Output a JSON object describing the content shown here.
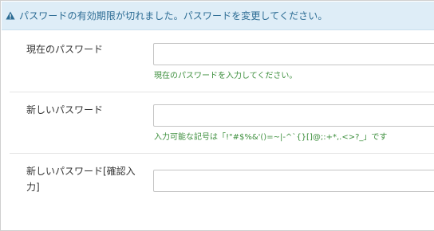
{
  "alert": {
    "icon": "warning-icon",
    "message": "パスワードの有効期限が切れました。パスワードを変更してください。"
  },
  "form": {
    "current_password": {
      "label": "現在のパスワード",
      "value": "",
      "hint": "現在のパスワードを入力してください。"
    },
    "new_password": {
      "label": "新しいパスワード",
      "value": "",
      "hint": "入力可能な記号は「!\"#$%&'()=~|-^`{}[]@;:+*,.<>?_」です"
    },
    "confirm_password": {
      "label_line1": "新しいパスワード[確認入",
      "label_line2": "力]",
      "value": ""
    }
  },
  "colors": {
    "alert_bg": "#deedf7",
    "alert_text": "#2c6c94",
    "hint_text": "#3d8f3d"
  }
}
